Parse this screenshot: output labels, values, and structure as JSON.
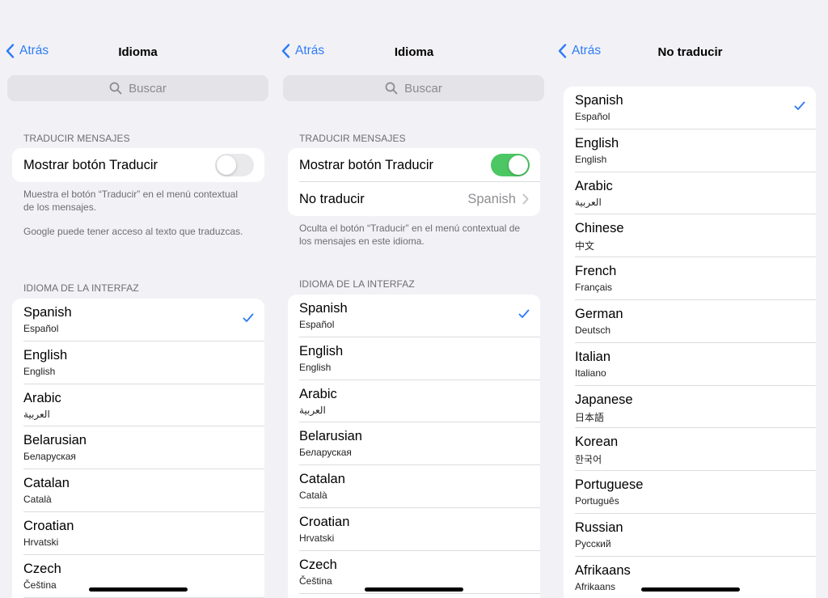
{
  "accent_color": "#2f7cf6",
  "toggle_on_color": "#4cc763",
  "panel1": {
    "back_label": "Atrás",
    "title": "Idioma",
    "search_placeholder": "Buscar",
    "section_translate": "TRADUCIR MENSAJES",
    "toggle_label": "Mostrar botón Traducir",
    "toggle_on": false,
    "note_1": "Muestra el botón “Traducir” en el menú contextual de los mensajes.",
    "note_2": "Google puede tener acceso al texto que traduzcas.",
    "section_interface": "IDIOMA DE LA INTERFAZ",
    "languages": [
      {
        "name": "Spanish",
        "native": "Español",
        "selected": true
      },
      {
        "name": "English",
        "native": "English"
      },
      {
        "name": "Arabic",
        "native": "العربية"
      },
      {
        "name": "Belarusian",
        "native": "Беларуская"
      },
      {
        "name": "Catalan",
        "native": "Català"
      },
      {
        "name": "Croatian",
        "native": "Hrvatski"
      },
      {
        "name": "Czech",
        "native": "Čeština"
      }
    ]
  },
  "panel2": {
    "back_label": "Atrás",
    "title": "Idioma",
    "search_placeholder": "Buscar",
    "section_translate": "TRADUCIR MENSAJES",
    "toggle_label": "Mostrar botón Traducir",
    "toggle_on": true,
    "no_translate_label": "No traducir",
    "no_translate_value": "Spanish",
    "note_1": "Oculta el botón “Traducir” en el menú contextual de los mensajes en este idioma.",
    "section_interface": "IDIOMA DE LA INTERFAZ",
    "languages": [
      {
        "name": "Spanish",
        "native": "Español",
        "selected": true
      },
      {
        "name": "English",
        "native": "English"
      },
      {
        "name": "Arabic",
        "native": "العربية"
      },
      {
        "name": "Belarusian",
        "native": "Беларуская"
      },
      {
        "name": "Catalan",
        "native": "Català"
      },
      {
        "name": "Croatian",
        "native": "Hrvatski"
      },
      {
        "name": "Czech",
        "native": "Čeština"
      }
    ]
  },
  "panel3": {
    "back_label": "Atrás",
    "title": "No traducir",
    "languages": [
      {
        "name": "Spanish",
        "native": "Español",
        "selected": true
      },
      {
        "name": "English",
        "native": "English"
      },
      {
        "name": "Arabic",
        "native": "العربية"
      },
      {
        "name": "Chinese",
        "native": "中文"
      },
      {
        "name": "French",
        "native": "Français"
      },
      {
        "name": "German",
        "native": "Deutsch"
      },
      {
        "name": "Italian",
        "native": "Italiano"
      },
      {
        "name": "Japanese",
        "native": "日本語"
      },
      {
        "name": "Korean",
        "native": "한국어"
      },
      {
        "name": "Portuguese",
        "native": "Português"
      },
      {
        "name": "Russian",
        "native": "Русский"
      },
      {
        "name": "Afrikaans",
        "native": "Afrikaans"
      }
    ]
  }
}
